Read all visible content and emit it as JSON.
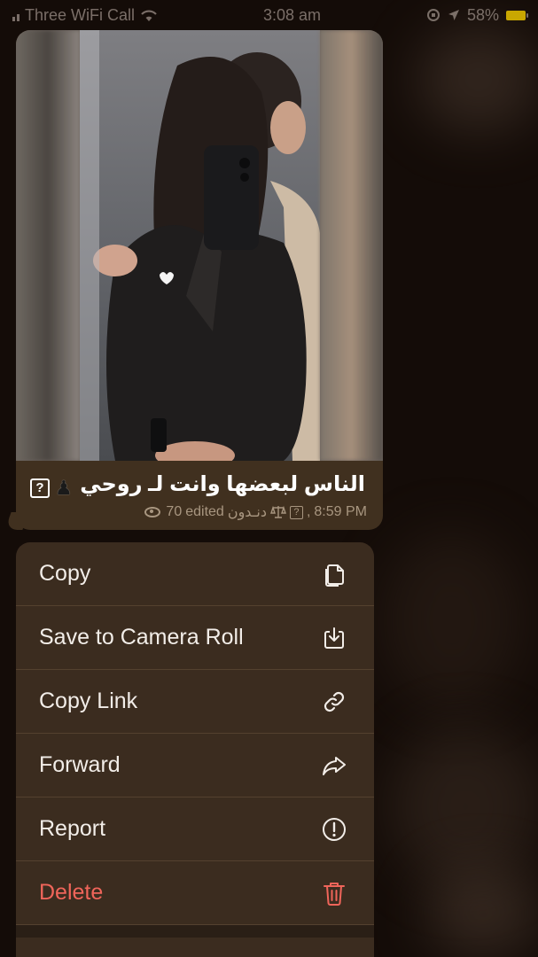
{
  "status_bar": {
    "carrier": "Three WiFi Call",
    "time": "3:08 am",
    "battery_percent": "58%"
  },
  "message": {
    "caption": "الناس لبعضها وانت لـ روحي",
    "views": "70",
    "edited_label": "edited",
    "author": "دنـدون",
    "time": "8:59 PM"
  },
  "menu": {
    "items": [
      {
        "label": "Copy",
        "icon": "copy-icon"
      },
      {
        "label": "Save to Camera Roll",
        "icon": "download-icon"
      },
      {
        "label": "Copy Link",
        "icon": "link-icon"
      },
      {
        "label": "Forward",
        "icon": "forward-icon"
      },
      {
        "label": "Report",
        "icon": "report-icon"
      },
      {
        "label": "Delete",
        "icon": "trash-icon",
        "color": "#f0655a"
      }
    ]
  }
}
